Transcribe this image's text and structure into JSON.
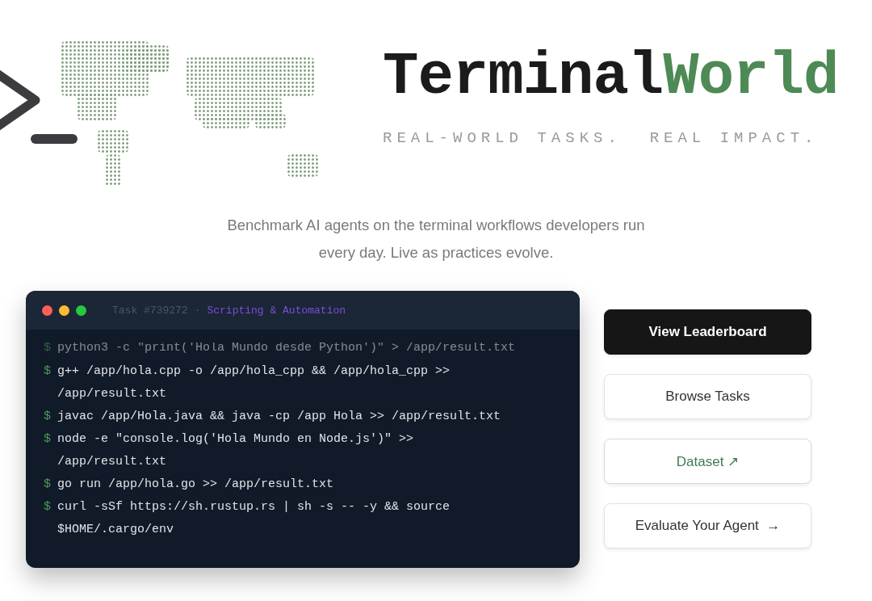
{
  "brand": {
    "name": "Terminal",
    "name_accent": "World",
    "tagline": "REAL-WORLD TASKS.  REAL IMPACT."
  },
  "description": "Benchmark AI agents on the terminal workflows developers run every day. Live as practices evolve.",
  "terminal": {
    "task_id": "Task #739272",
    "separator": "·",
    "category": "Scripting & Automation",
    "lines": [
      {
        "kind": "faded",
        "prompt": "$",
        "text": "python3 -c \"print('Hola Mundo desde Python')\" > /app/result.txt"
      },
      {
        "kind": "command",
        "prompt": "$",
        "text": "g++ /app/hola.cpp -o /app/hola_cpp && /app/hola_cpp >> /app/result.txt"
      },
      {
        "kind": "command",
        "prompt": "$",
        "text": "javac /app/Hola.java && java -cp /app Hola >> /app/result.txt"
      },
      {
        "kind": "command",
        "prompt": "$",
        "text": "node -e \"console.log('Hola Mundo en Node.js')\" >> /app/result.txt"
      },
      {
        "kind": "command",
        "prompt": "$",
        "text": "go run /app/hola.go >> /app/result.txt"
      },
      {
        "kind": "command",
        "prompt": "$",
        "text": "curl -sSf https://sh.rustup.rs | sh -s -- -y && source $HOME/.cargo/env"
      }
    ]
  },
  "buttons": [
    {
      "kind": "primary",
      "label": "View Leaderboard"
    },
    {
      "kind": "secondary",
      "label": "Browse Tasks"
    },
    {
      "kind": "accent",
      "label": "Dataset ↗"
    },
    {
      "kind": "secondary",
      "label": "Evaluate Your Agent  →"
    }
  ]
}
